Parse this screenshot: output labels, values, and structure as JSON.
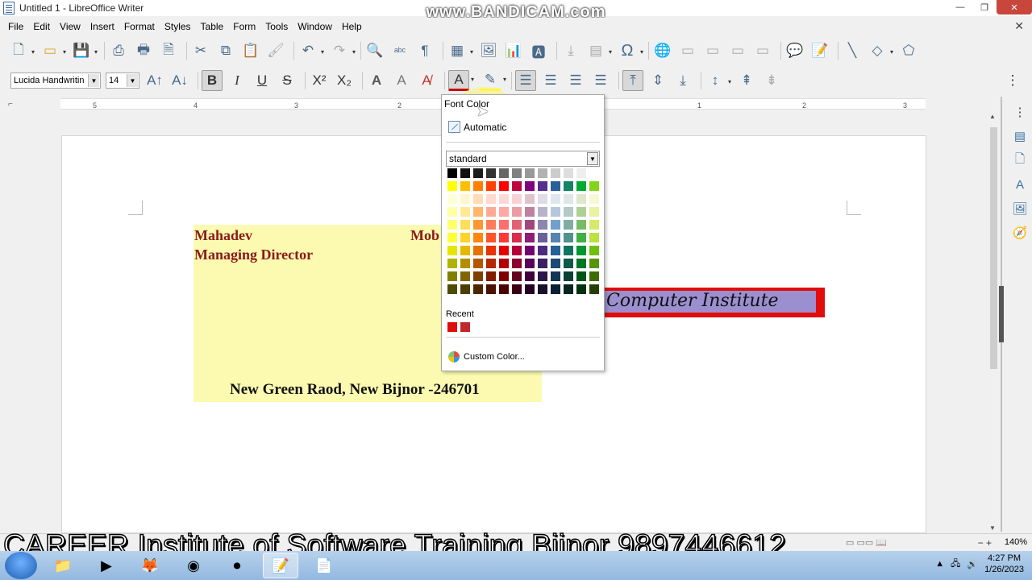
{
  "window": {
    "title": "Untitled 1 - LibreOffice Writer",
    "watermark": "www.BANDICAM.com",
    "controls": [
      "—",
      "❐",
      "✕"
    ]
  },
  "menu": [
    "File",
    "Edit",
    "View",
    "Insert",
    "Format",
    "Styles",
    "Table",
    "Form",
    "Tools",
    "Window",
    "Help"
  ],
  "formatting": {
    "font_name": "Lucida Handwritin",
    "font_size": "14"
  },
  "ruler": {
    "ticks": [
      "5",
      "4",
      "3",
      "2",
      "1",
      "1",
      "2",
      "3"
    ]
  },
  "document": {
    "name_line": "Mahadev",
    "mobile_partial": "Mob",
    "designation": "Managing Director",
    "address": "New Green Raod, New Bijnor -246701",
    "institute": "Computer Institute"
  },
  "font_color_popup": {
    "title": "Font Color",
    "automatic_label": "Automatic",
    "palette": "standard",
    "recent_label": "Recent",
    "custom_label": "Custom Color...",
    "swatches": [
      "#000000",
      "#111111",
      "#1c1c1c",
      "#333333",
      "#666666",
      "#808080",
      "#999999",
      "#b2b2b2",
      "#cccccc",
      "#dddddd",
      "#eeeeee",
      "#ffffff",
      "#ffff00",
      "#ffbf00",
      "#ff8000",
      "#ff4000",
      "#ff0000",
      "#bf0041",
      "#800080",
      "#55308d",
      "#2a6099",
      "#158466",
      "#00a933",
      "#81d41a",
      "#ffffd7",
      "#fff5ce",
      "#ffdbb6",
      "#ffd8ce",
      "#ffd7d7",
      "#f7d1d5",
      "#e0c2cd",
      "#dedce6",
      "#dee6ef",
      "#dee7e5",
      "#dde8cb",
      "#f6f9d4",
      "#ffffa6",
      "#ffe994",
      "#ffb66c",
      "#ffaa95",
      "#ffa6a6",
      "#ec9ba4",
      "#bf819e",
      "#b7b3ca",
      "#b4c7dc",
      "#b3cac7",
      "#afd095",
      "#e8f2a1",
      "#ffff6d",
      "#ffde59",
      "#ff972f",
      "#ff7b59",
      "#ff6d6d",
      "#e16173",
      "#a1467e",
      "#8e86ae",
      "#729fcf",
      "#81aca6",
      "#77bc65",
      "#d4ea6b",
      "#ffff38",
      "#ffd428",
      "#ff860d",
      "#ff5429",
      "#ff3838",
      "#d62e4e",
      "#8d1d75",
      "#6b5e9b",
      "#5983b0",
      "#50938a",
      "#3faf46",
      "#bbe33d",
      "#e6e600",
      "#e6b800",
      "#e67300",
      "#e63300",
      "#e60000",
      "#b3003c",
      "#730073",
      "#4c2b80",
      "#256096",
      "#127360",
      "#009632",
      "#71bf0d",
      "#b2b200",
      "#b28f00",
      "#b25900",
      "#b22800",
      "#b20000",
      "#8c002f",
      "#590059",
      "#3b2163",
      "#1c4a75",
      "#0e594a",
      "#007526",
      "#589409",
      "#808000",
      "#806600",
      "#804000",
      "#801d00",
      "#800000",
      "#640021",
      "#400040",
      "#2a184a",
      "#143554",
      "#0a4035",
      "#00541b",
      "#3f6b06",
      "#4d4d00",
      "#4d3d00",
      "#4d2600",
      "#4d1100",
      "#4d0000",
      "#3c0014",
      "#260026",
      "#191029",
      "#0c2033",
      "#062620",
      "#003210",
      "#264004"
    ],
    "recent": [
      "#e10c0c",
      "#c0272d"
    ]
  },
  "statusbar": {
    "zoom": "140%",
    "zoom_controls": "−  +"
  },
  "caption": "CAREER Institute of Software Training Bijnor 9897446612",
  "taskbar": {
    "time": "4:27 PM",
    "date": "1/26/2023"
  }
}
